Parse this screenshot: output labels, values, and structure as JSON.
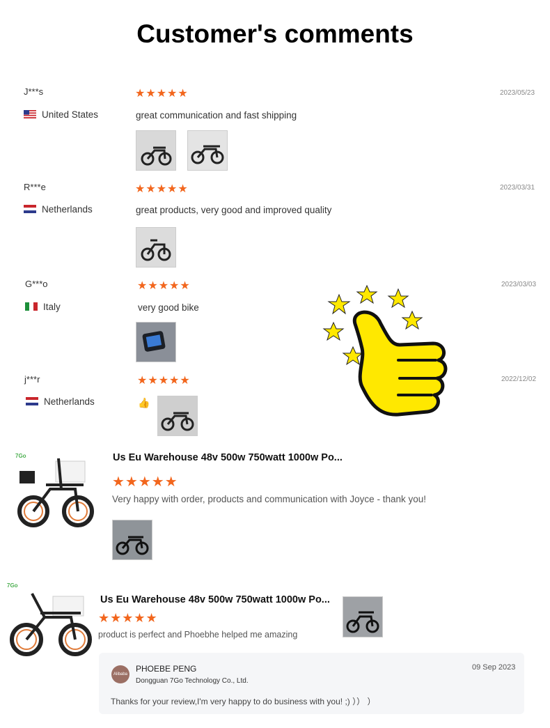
{
  "page": {
    "title": "Customer's comments"
  },
  "reviews": [
    {
      "user": "J***s",
      "country": "United States",
      "stars": "★★★★★",
      "date": "2023/05/23",
      "text": "great communication and fast shipping",
      "flag": "us"
    },
    {
      "user": "R***e",
      "country": "Netherlands",
      "stars": "★★★★★",
      "date": "2023/03/31",
      "text": "great products, very good and improved quality",
      "flag": "nl"
    },
    {
      "user": "G***o",
      "country": "Italy",
      "stars": "★★★★★",
      "date": "2023/03/03",
      "text": "very good bike",
      "flag": "it"
    },
    {
      "user": "j***r",
      "country": "Netherlands",
      "stars": "★★★★★",
      "date": "2022/12/02",
      "text": "",
      "flag": "nl"
    }
  ],
  "product_reviews": [
    {
      "title": "Us Eu Warehouse 48v 500w 750watt 1000w Po...",
      "stars": "★★★★★",
      "text": "Very happy with order, products and communication with Joyce - thank you!",
      "brand": "7Go"
    },
    {
      "title": "Us Eu Warehouse 48v 500w 750watt 1000w Po...",
      "stars": "★★★★★",
      "text": "product is perfect and Phoebhe helped me amazing",
      "brand": "7Go"
    }
  ],
  "reply": {
    "name": "PHOEBE PENG",
    "company": "Dongguan 7Go Technology Co., Ltd.",
    "date": "09 Sep 2023",
    "text": "Thanks for your review,I'm very happy to do business with you! ;) ）） ）",
    "avatar_label": "Alibaba"
  },
  "colors": {
    "star": "#f2661d",
    "thumbs_up": "#ffe800"
  }
}
